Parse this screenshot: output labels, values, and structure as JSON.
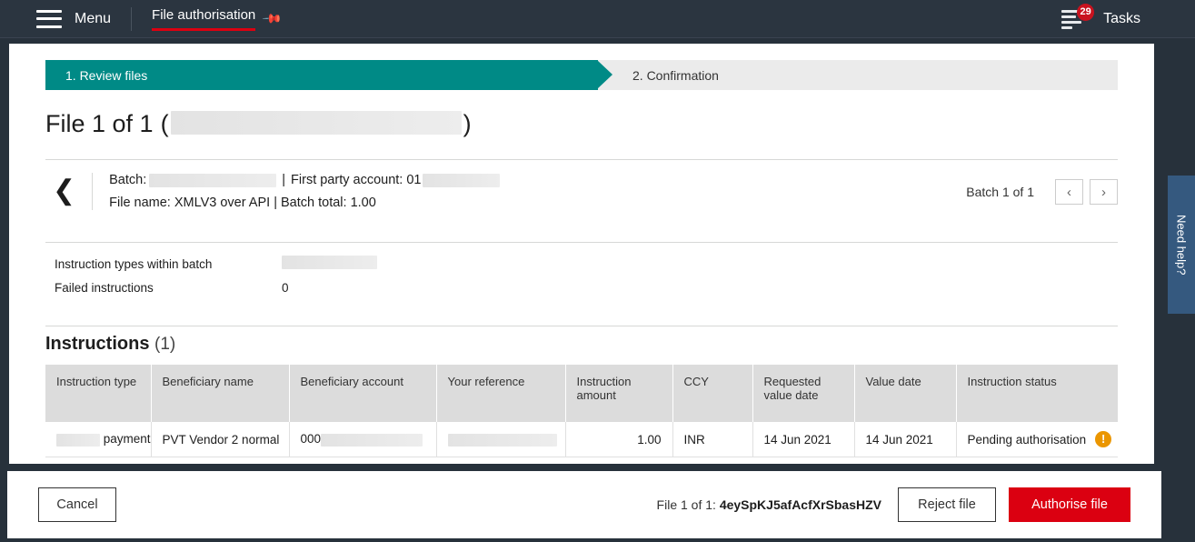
{
  "topnav": {
    "menu_label": "Menu",
    "page_tab": "File authorisation",
    "pin_icon": "pin-icon",
    "tasks_label": "Tasks",
    "tasks_badge": "29",
    "accent_red": "#db0011"
  },
  "steps": [
    {
      "label": "1. Review files",
      "state": "active",
      "color": "#008a86"
    },
    {
      "label": "2. Confirmation",
      "state": "inactive",
      "color": "#ebebeb"
    }
  ],
  "file_title": {
    "prefix": "File 1 of 1",
    "open_paren": "(",
    "close_paren": ")"
  },
  "batch": {
    "label_batch": "Batch:",
    "separator": "|",
    "label_first_party": "First party account: 01",
    "line2": "File name: XMLV3 over API | Batch total: 1.00",
    "count": "Batch 1 of 1",
    "prev_icon": "chevron-left-icon",
    "next_icon": "chevron-right-icon",
    "back_icon": "chevron-left-icon"
  },
  "summary": [
    {
      "label": "Instruction types within batch",
      "value": "",
      "redacted": true
    },
    {
      "label": "Failed instructions",
      "value": "0",
      "redacted": false
    }
  ],
  "instructions": {
    "heading": "Instructions",
    "count": "(1)",
    "columns": [
      "Instruction type",
      "Beneficiary name",
      "Beneficiary account",
      "Your reference",
      "Instruction amount",
      "CCY",
      "Requested value date",
      "Value date",
      "Instruction status"
    ],
    "rows": [
      {
        "instruction_type": "payments",
        "beneficiary_name": "PVT Vendor 2 normal",
        "beneficiary_account": "000",
        "your_reference": "",
        "instruction_amount": "1.00",
        "ccy": "INR",
        "requested_value_date": "14 Jun 2021",
        "value_date": "14 Jun 2021",
        "instruction_status": "Pending authorisation",
        "status_icon": "warning-exclamation-icon",
        "status_color": "#eb9600"
      }
    ]
  },
  "need_help": {
    "label": "Need help?",
    "color": "#35597f"
  },
  "footer": {
    "cancel_label": "Cancel",
    "file_id_prefix": "File 1 of 1: ",
    "file_id": "4eySpKJ5afAcfXrSbasHZV",
    "reject_label": "Reject file",
    "authorise_label": "Authorise file"
  }
}
